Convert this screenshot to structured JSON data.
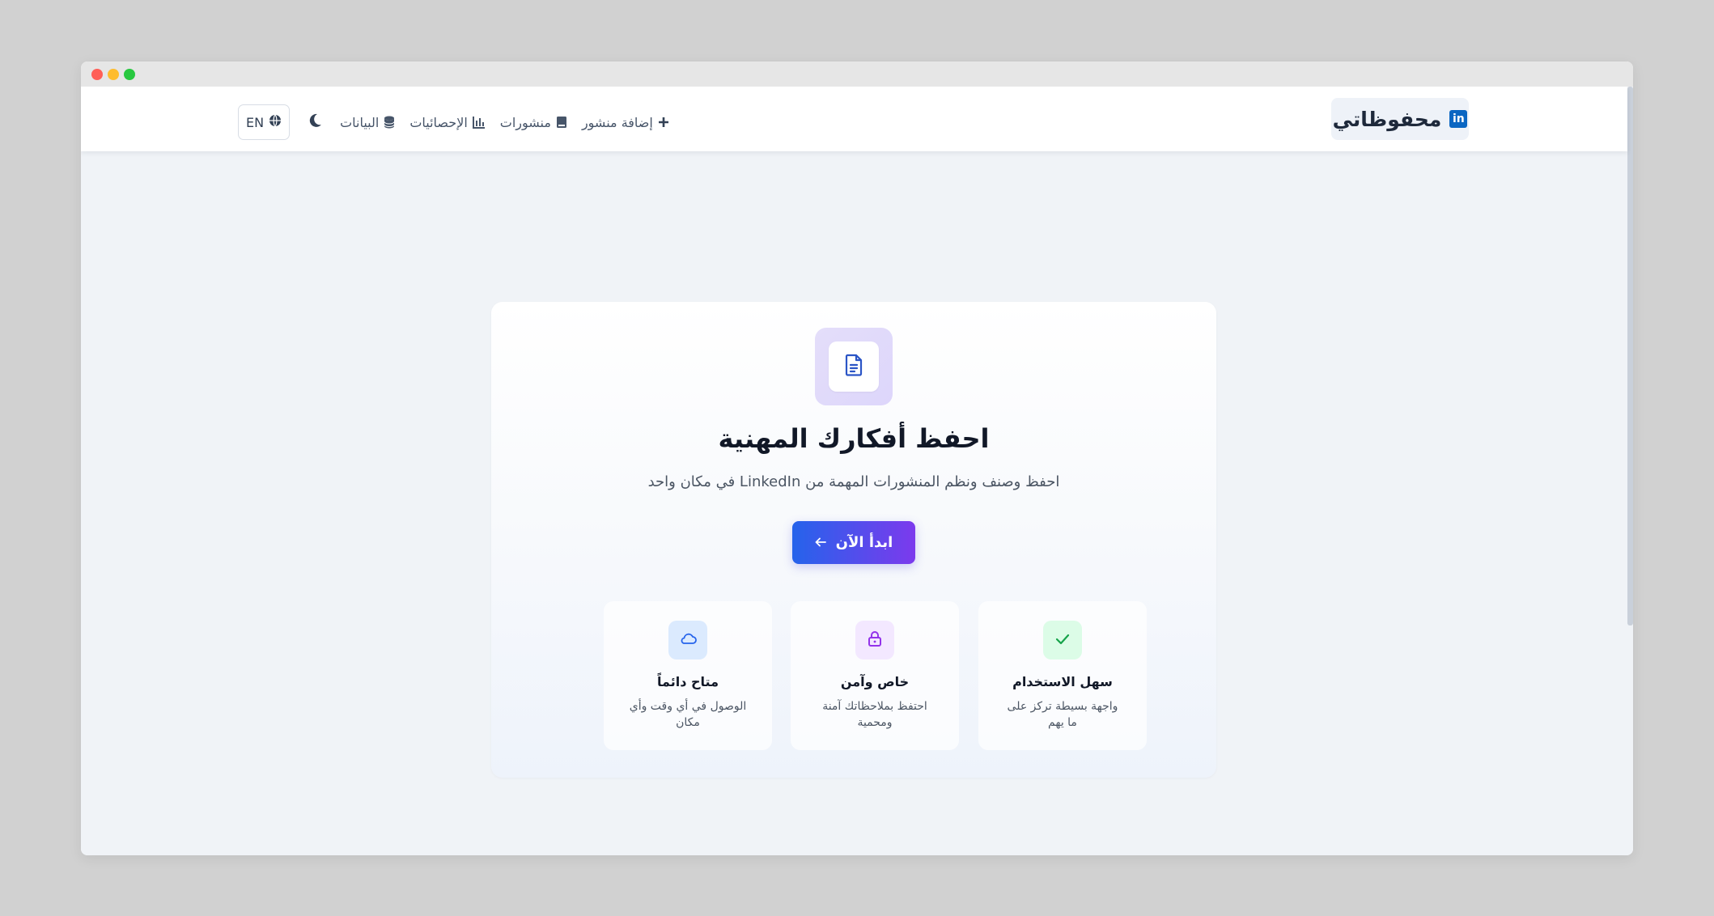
{
  "brand": {
    "title": "محفوظاتي",
    "logo_text": "in",
    "logo_color": "#0a66c2"
  },
  "nav": {
    "lang_label": "EN",
    "items": [
      {
        "label": "إضافة منشور",
        "icon": "plus-icon"
      },
      {
        "label": "منشورات",
        "icon": "book-icon"
      },
      {
        "label": "الإحصائيات",
        "icon": "bar-chart-icon"
      },
      {
        "label": "البيانات",
        "icon": "database-icon"
      }
    ],
    "theme_icon": "moon-icon",
    "lang_icon": "globe-icon"
  },
  "hero": {
    "icon": "document-icon",
    "title": "احفظ أفكارك المهنية",
    "subtitle": "احفظ وصنف ونظم المنشورات المهمة من LinkedIn في مكان واحد",
    "cta_label": "ابدأ الآن",
    "cta_icon": "arrow-left-icon"
  },
  "features": [
    {
      "title": "سهل الاستخدام",
      "desc": "واجهة بسيطة تركز على ما يهم",
      "icon": "check-icon",
      "bg": "#dcfce7",
      "color": "#16a34a"
    },
    {
      "title": "خاص وآمن",
      "desc": "احتفظ بملاحظاتك آمنة ومحمية",
      "icon": "lock-icon",
      "bg": "#f3e8ff",
      "color": "#9333ea"
    },
    {
      "title": "متاح دائماً",
      "desc": "الوصول في أي وقت وأي مكان",
      "icon": "cloud-icon",
      "bg": "#dbeafe",
      "color": "#2563eb"
    }
  ],
  "colors": {
    "accent_start": "#2563eb",
    "accent_end": "#7c3aed"
  }
}
